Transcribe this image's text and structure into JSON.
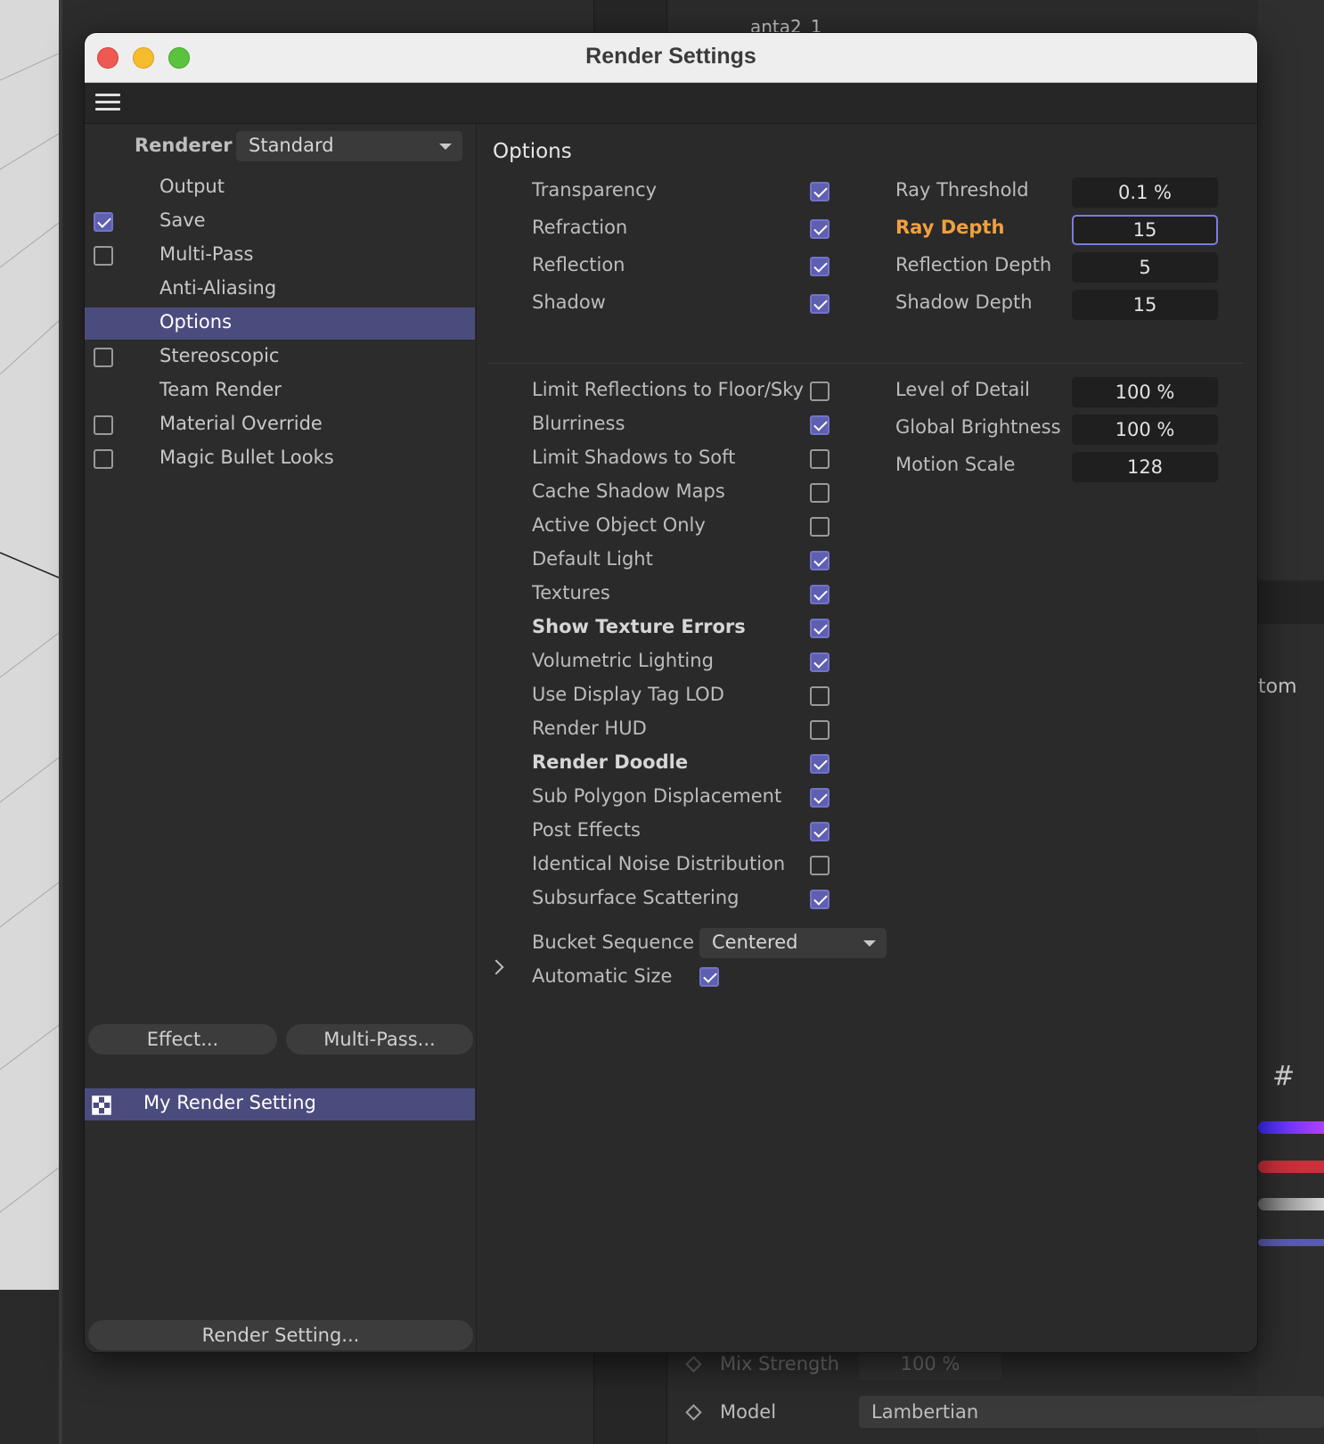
{
  "background": {
    "top_object_label": "anta2_1",
    "right_fragment_text": "tom",
    "hash_button": "#",
    "bottom_rows": [
      {
        "label": "Mix Strength",
        "value": "100 %"
      },
      {
        "label": "Model",
        "value": "Lambertian"
      }
    ],
    "bar_colors": [
      "#6a2cff",
      "#c8303a",
      "#9a9a9a",
      "#5a5ab0"
    ]
  },
  "window": {
    "title": "Render Settings",
    "menu_icon": "hamburger-menu-icon"
  },
  "left": {
    "renderer_label": "Renderer",
    "renderer_value": "Standard",
    "items": [
      {
        "label": "Output",
        "checkbox": null,
        "selected": false
      },
      {
        "label": "Save",
        "checkbox": true,
        "selected": false
      },
      {
        "label": "Multi-Pass",
        "checkbox": false,
        "selected": false
      },
      {
        "label": "Anti-Aliasing",
        "checkbox": null,
        "selected": false
      },
      {
        "label": "Options",
        "checkbox": null,
        "selected": true
      },
      {
        "label": "Stereoscopic",
        "checkbox": false,
        "selected": false
      },
      {
        "label": "Team Render",
        "checkbox": null,
        "selected": false
      },
      {
        "label": "Material Override",
        "checkbox": false,
        "selected": false
      },
      {
        "label": "Magic Bullet Looks",
        "checkbox": false,
        "selected": false
      }
    ],
    "effect_button": "Effect...",
    "multipass_button": "Multi-Pass...",
    "render_setting_name": "My Render Setting",
    "render_setting_button": "Render Setting..."
  },
  "options": {
    "title": "Options",
    "checks_top": [
      {
        "label": "Transparency",
        "checked": true,
        "bold": false
      },
      {
        "label": "Refraction",
        "checked": true,
        "bold": false
      },
      {
        "label": "Reflection",
        "checked": true,
        "bold": false
      },
      {
        "label": "Shadow",
        "checked": true,
        "bold": false
      }
    ],
    "checks_bottom": [
      {
        "label": "Limit Reflections to Floor/Sky",
        "checked": false,
        "bold": false
      },
      {
        "label": "Blurriness",
        "checked": true,
        "bold": false
      },
      {
        "label": "Limit Shadows to Soft",
        "checked": false,
        "bold": false
      },
      {
        "label": "Cache Shadow Maps",
        "checked": false,
        "bold": false
      },
      {
        "label": "Active Object Only",
        "checked": false,
        "bold": false
      },
      {
        "label": "Default Light",
        "checked": true,
        "bold": false
      },
      {
        "label": "Textures",
        "checked": true,
        "bold": false
      },
      {
        "label": "Show Texture Errors",
        "checked": true,
        "bold": true
      },
      {
        "label": "Volumetric Lighting",
        "checked": true,
        "bold": false
      },
      {
        "label": "Use Display Tag LOD",
        "checked": false,
        "bold": false
      },
      {
        "label": "Render HUD",
        "checked": false,
        "bold": false
      },
      {
        "label": "Render Doodle",
        "checked": true,
        "bold": true
      },
      {
        "label": "Sub Polygon Displacement",
        "checked": true,
        "bold": false
      },
      {
        "label": "Post Effects",
        "checked": true,
        "bold": false
      },
      {
        "label": "Identical Noise Distribution",
        "checked": false,
        "bold": false
      },
      {
        "label": "Subsurface Scattering",
        "checked": true,
        "bold": false
      }
    ],
    "fields_top": [
      {
        "label": "Ray Threshold",
        "value": "0.1 %",
        "focused": false
      },
      {
        "label": "Ray Depth",
        "value": "15",
        "focused": true
      },
      {
        "label": "Reflection Depth",
        "value": "5",
        "focused": false
      },
      {
        "label": "Shadow Depth",
        "value": "15",
        "focused": false
      }
    ],
    "fields_bottom": [
      {
        "label": "Level of Detail",
        "value": "100 %",
        "focused": false
      },
      {
        "label": "Global Brightness",
        "value": "100 %",
        "focused": false
      },
      {
        "label": "Motion Scale",
        "value": "128",
        "focused": false
      }
    ],
    "bucket_sequence_label": "Bucket Sequence",
    "bucket_sequence_value": "Centered",
    "automatic_size_label": "Automatic Size",
    "automatic_size_checked": true,
    "accent_color": "#f0a040",
    "selection_color": "#4b4c7e"
  }
}
